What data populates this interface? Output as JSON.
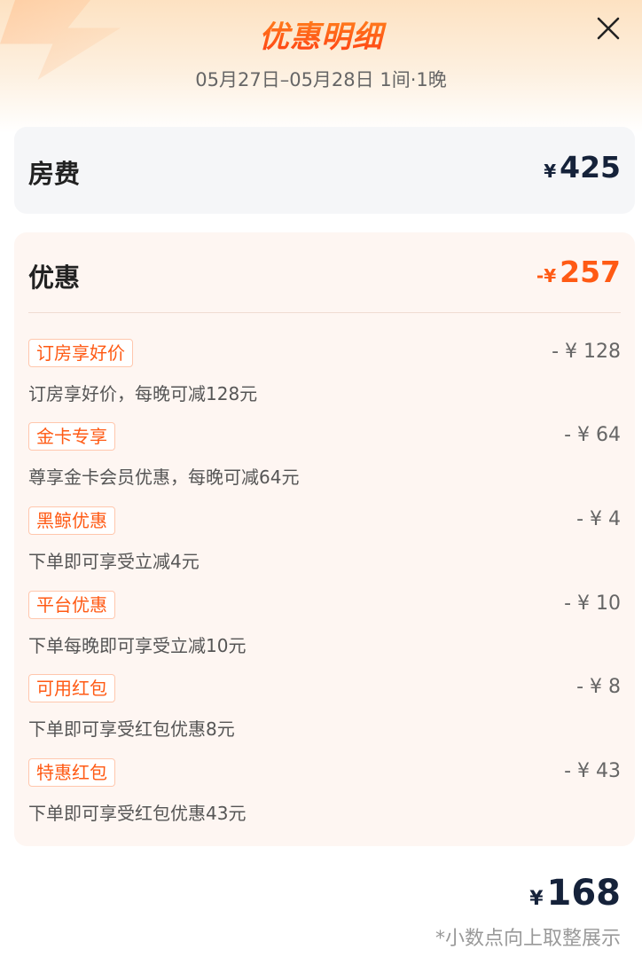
{
  "header": {
    "title": "优惠明细",
    "subtitle": "05月27日–05月28日 1间·1晚",
    "close_icon": "close-icon"
  },
  "room_fee": {
    "label": "房费",
    "currency": "¥",
    "amount": "425"
  },
  "discount": {
    "label": "优惠",
    "prefix": "-¥",
    "amount": "257",
    "items": [
      {
        "tag": "订房享好价",
        "amount": "- ¥ 128",
        "description": "订房享好价，每晚可减128元"
      },
      {
        "tag": "金卡专享",
        "amount": "- ¥ 64",
        "description": "尊享金卡会员优惠，每晚可减64元"
      },
      {
        "tag": "黑鲸优惠",
        "amount": "- ¥ 4",
        "description": "下单即可享受立减4元"
      },
      {
        "tag": "平台优惠",
        "amount": "- ¥ 10",
        "description": "下单每晚即可享受立减10元"
      },
      {
        "tag": "可用红包",
        "amount": "- ¥ 8",
        "description": "下单即可享受红包优惠8元"
      },
      {
        "tag": "特惠红包",
        "amount": "- ¥ 43",
        "description": "下单即可享受红包优惠43元"
      }
    ]
  },
  "total": {
    "currency": "¥",
    "amount": "168",
    "note": "*小数点向上取整展示"
  },
  "colors": {
    "accent": "#ff5a14",
    "navy": "#15223a",
    "card_room_bg": "#f5f6f8",
    "card_discount_bg": "#fef6f2"
  }
}
